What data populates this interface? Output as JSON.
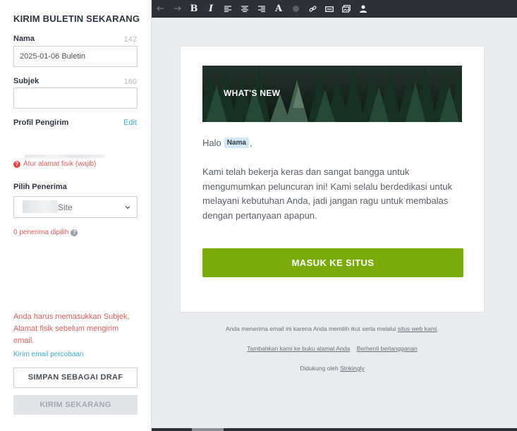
{
  "panel": {
    "title": "KIRIM BULETIN SEKARANG",
    "name_label": "Nama",
    "name_count": "142",
    "name_value": "2025-01-06 Buletin",
    "subject_label": "Subjek",
    "subject_count": "160",
    "subject_value": "",
    "sender_label": "Profil Pengirim",
    "edit_label": "Edit",
    "address_warning": "Atur alamat fisik (wajib)",
    "recipients_label": "Pilih Penerima",
    "recipients_selected": "Site",
    "recipients_count_text": "0 penerima dipilih",
    "error_message": "Anda harus memasukkan Subjek, Alamat fisik sebelum mengirim email.",
    "test_email_link": "Kirim email percobaan",
    "save_draft_label": "SIMPAN SEBAGAI DRAF",
    "send_now_label": "KIRIM SEKARANG"
  },
  "toolbar": {
    "icons": [
      "undo-icon",
      "redo-icon",
      "bold-icon",
      "italic-icon",
      "align-left-icon",
      "align-center-icon",
      "align-right-icon",
      "font-icon",
      "color-icon",
      "link-icon",
      "button-icon",
      "image-icon",
      "person-icon"
    ],
    "bold": "B",
    "italic": "I",
    "font": "A"
  },
  "email": {
    "banner_text": "WHAT'S NEW",
    "greeting": "Halo",
    "name_tag": "Nama",
    "greeting_suffix": ",",
    "body": "Kami telah bekerja keras dan sangat bangga untuk mengumumkan peluncuran ini! Kami selalu berdedikasi untuk melayani kebutuhan Anda, jadi jangan ragu untuk membalas dengan pertanyaan apapun.",
    "cta_label": "MASUK KE SITUS"
  },
  "footer": {
    "reason_text": "Anda menerima email ini karena Anda memilih ikut serta melalui",
    "reason_link": "situs web kami",
    "reason_end": ".",
    "address_book_link": "Tambahkan kami ke buku alamat Anda",
    "unsubscribe_link": "Berhenti berlangganan",
    "powered_text": "Didukung oleh",
    "powered_link": "Strikingly"
  },
  "colors": {
    "accent_link": "#3fa9cf",
    "error": "#e35d5d",
    "cta": "#7aab0b",
    "toolbar": "#2d3036"
  }
}
